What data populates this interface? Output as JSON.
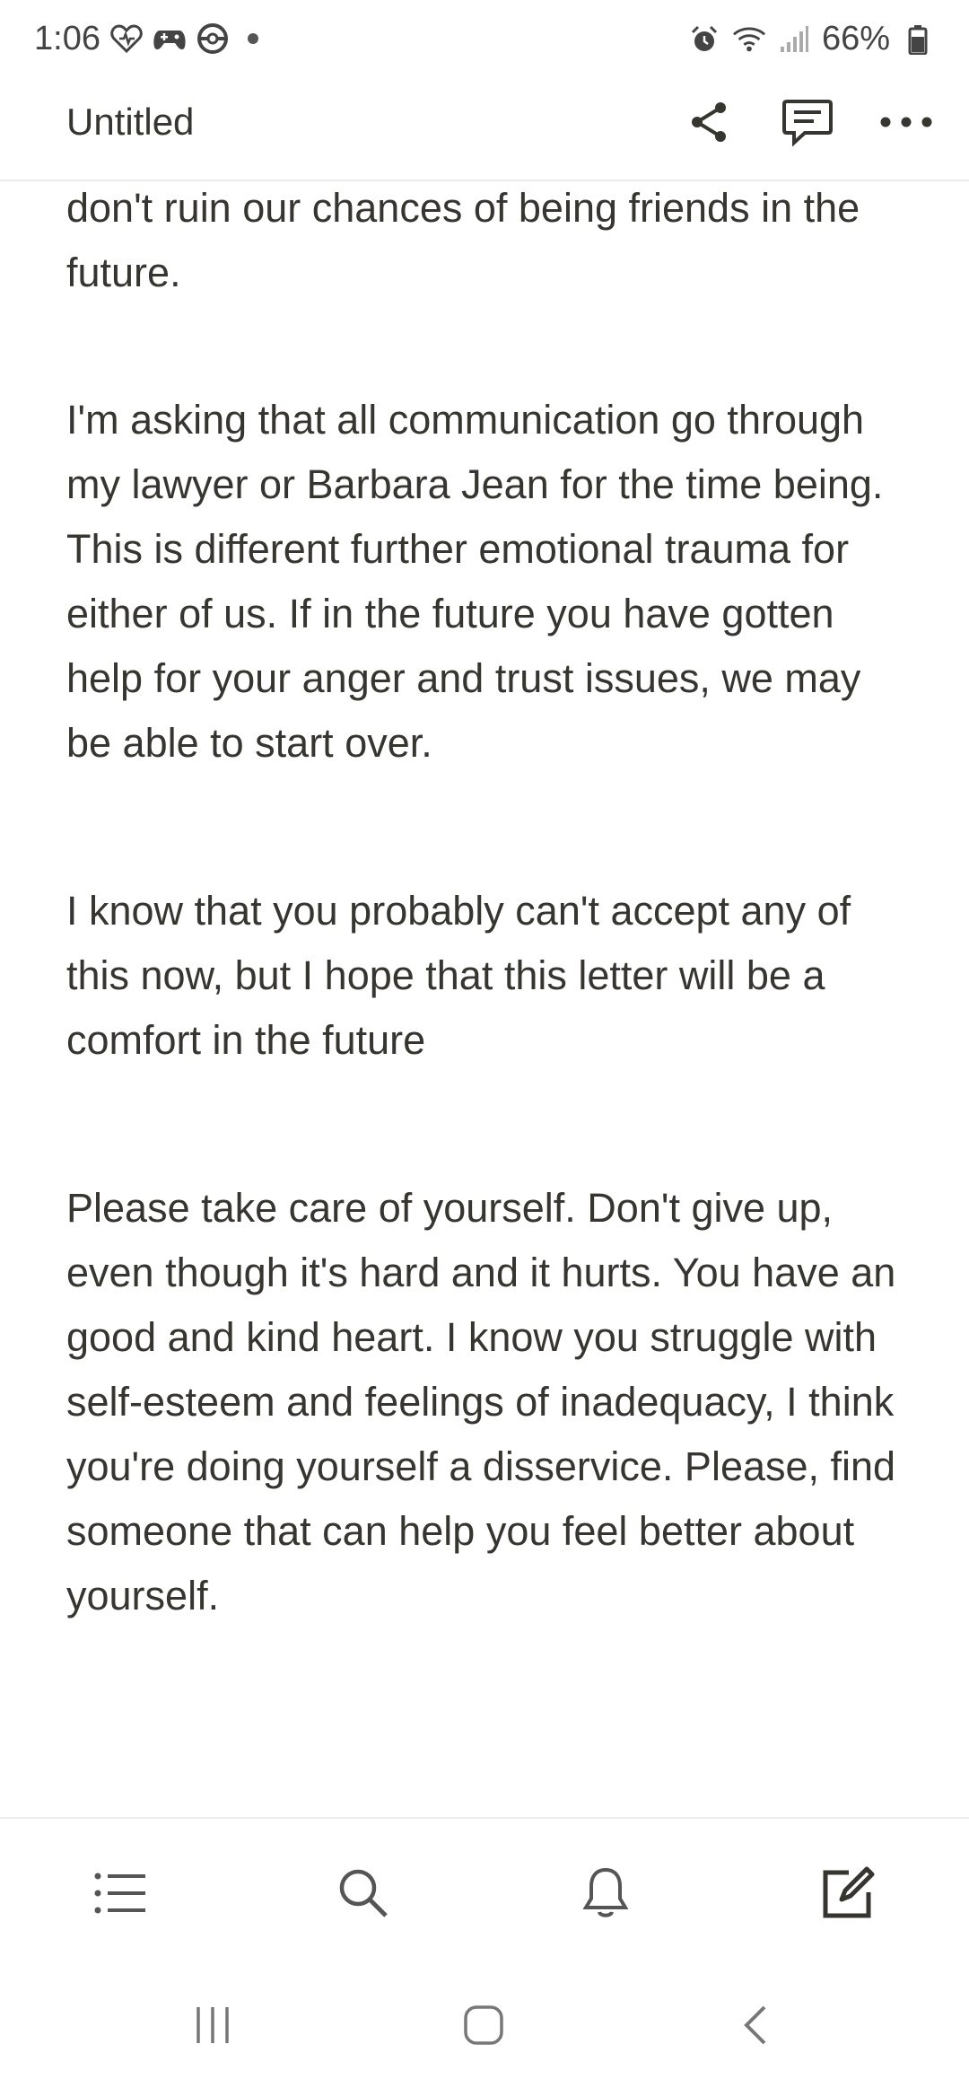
{
  "status_bar": {
    "time": "1:06",
    "battery": "66%",
    "left_icons": [
      "health-icon",
      "game-controller-icon",
      "pokeball-icon",
      "notification-dot"
    ],
    "right_icons": [
      "alarm-icon",
      "wifi-icon",
      "signal-icon",
      "battery-icon"
    ]
  },
  "header": {
    "title": "Untitled",
    "actions": [
      "share-icon",
      "comment-icon",
      "more-icon"
    ]
  },
  "content": {
    "paragraphs": [
      "don't ruin our chances of being friends in the future.",
      "I'm asking that all communication go through my lawyer or Barbara Jean for the time being. This is different further emotional trauma for either of us. If in the future you have gotten help for your anger and trust issues, we may be able to start over.",
      "I know that you probably can't accept any of this now, but I hope that this letter will be a comfort in the future",
      "Please take care of yourself. Don't give up, even though it's hard and it hurts. You have an good and kind heart. I know you struggle with self-esteem and feelings of inadequacy, I think you're doing yourself a disservice.  Please, find someone that can help you feel better about yourself."
    ]
  },
  "toolbar": {
    "items": [
      "list-icon",
      "search-icon",
      "bell-icon",
      "compose-icon"
    ]
  },
  "navbar": {
    "items": [
      "recents-icon",
      "home-icon",
      "back-icon"
    ]
  },
  "colors": {
    "text": "#37352f",
    "divider": "#ececec",
    "background": "#ffffff"
  }
}
